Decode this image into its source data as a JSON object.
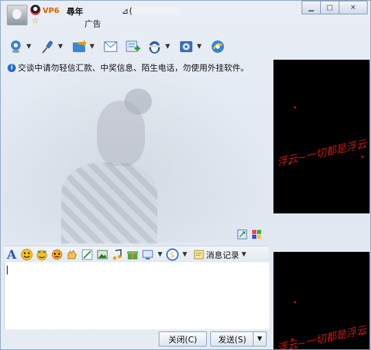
{
  "header": {
    "vip_badge": "VP6",
    "nickname": "尋年",
    "qq_number_prefix": "⊿(",
    "ad_label": "广告"
  },
  "window_controls": {
    "minimize": "▁",
    "maximize": "□",
    "close": "✕"
  },
  "toolbar": {
    "icons": [
      "video-camera-icon",
      "microphone-icon",
      "folder-transfer-icon",
      "mail-icon",
      "add-contact-icon",
      "qq-penguin-tools-icon",
      "settings-icon",
      "qq-app-icon"
    ]
  },
  "warning": {
    "icon": "i",
    "text": "交谈中请勿轻信汇款、中奖信息、陌生电话，勿使用外挂软件。"
  },
  "format_bar": {
    "font_label": "A",
    "history_label": "消息记录"
  },
  "buttons": {
    "close": "关闭(C)",
    "send": "发送(S)",
    "dropdown_arrow": "▼"
  },
  "panels": {
    "top_text": "浮云~一切都是浮云",
    "bottom_text": "浮云~一切都是浮云"
  }
}
